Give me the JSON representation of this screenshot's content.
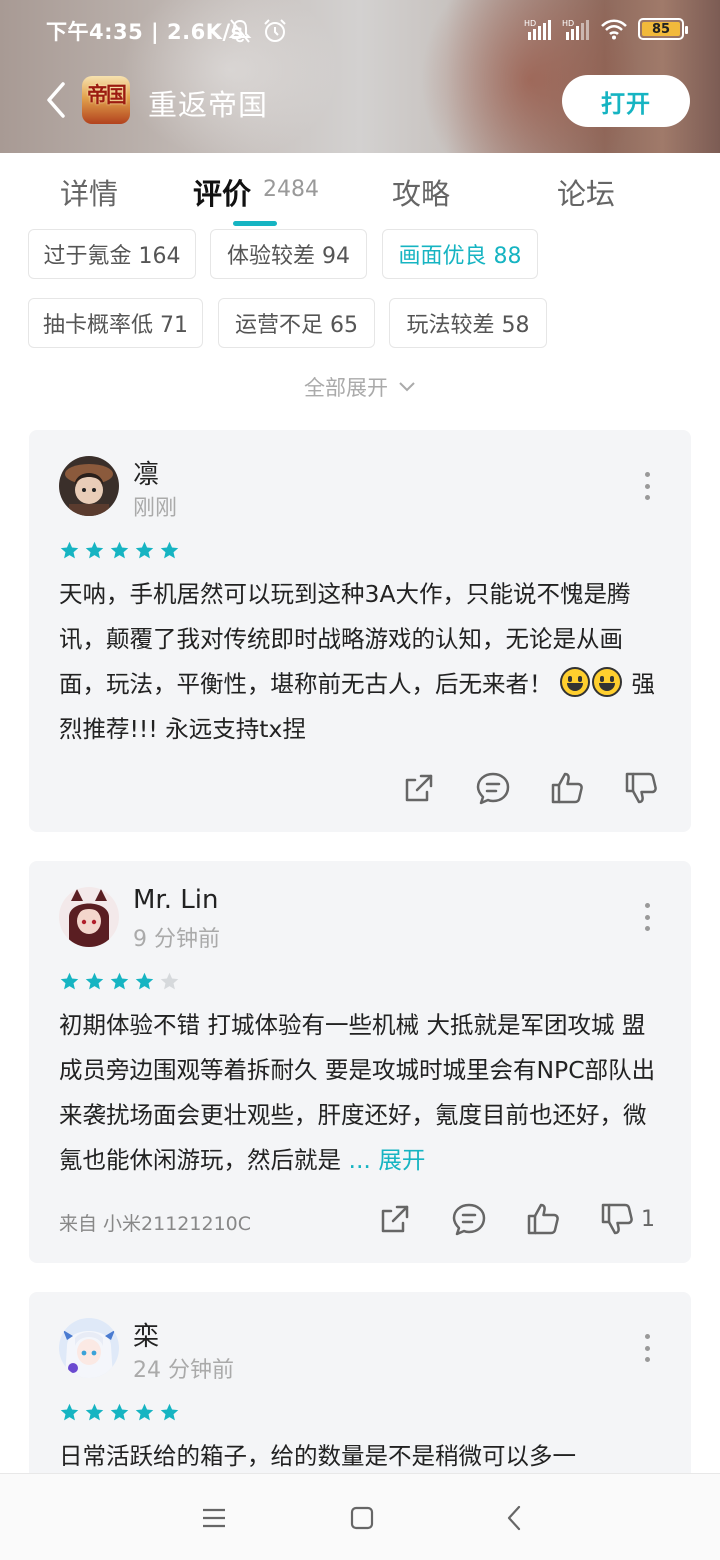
{
  "status_bar": {
    "time": "下午4:35 | 2.6K/s",
    "battery_level": "85",
    "icons": [
      "mute-bell-icon",
      "alarm-icon",
      "hd-signal-icon",
      "hd-signal-icon",
      "wifi-icon",
      "battery-icon"
    ]
  },
  "header": {
    "app_icon_text": "帝国",
    "app_title": "重返帝国",
    "open_button": "打开"
  },
  "tabs": {
    "items": [
      {
        "label": "详情"
      },
      {
        "label": "评价"
      },
      {
        "label": "攻略"
      },
      {
        "label": "论坛"
      }
    ],
    "review_count": "2484",
    "active": "评价"
  },
  "filters": {
    "chips": [
      {
        "label": "过于氪金 164",
        "active": false
      },
      {
        "label": "体验较差 94",
        "active": false
      },
      {
        "label": "画面优良 88",
        "active": true
      },
      {
        "label": "抽卡概率低 71",
        "active": false
      },
      {
        "label": "运营不足 65",
        "active": false
      },
      {
        "label": "玩法较差 58",
        "active": false
      }
    ],
    "expand_all": "全部展开"
  },
  "reviews": [
    {
      "user": "凛",
      "time": "刚刚",
      "rating": 5,
      "text_part1": "天呐，手机居然可以玩到这种3A大作，只能说不愧是腾讯，颠覆了我对传统即时战略游戏的认知，无论是从画面，玩法，平衡性，堪称前无古人，后无来者！",
      "text_part2": "强烈推荐!!! 永远支持tx捏"
    },
    {
      "user": "Mr. Lin",
      "time": "9 分钟前",
      "rating": 4,
      "text": "初期体验不错 打城体验有一些机械 大抵就是军团攻城 盟成员旁边围观等着拆耐久 要是攻城时城里会有NPC部队出来袭扰场面会更壮观些，肝度还好，氪度目前也还好，微氪也能休闲游玩，然后就是",
      "expand_label": "... 展开",
      "source": "来自 小米21121210C",
      "dislike_count": "1"
    },
    {
      "user": "栾",
      "time": "24 分钟前",
      "rating": 5,
      "text": "日常活跃给的箱子，给的数量是不是稍微可以多一"
    }
  ],
  "colors": {
    "accent": "#16b4c2",
    "star_empty": "#d6d9dc",
    "card_bg": "#f4f5f7"
  }
}
